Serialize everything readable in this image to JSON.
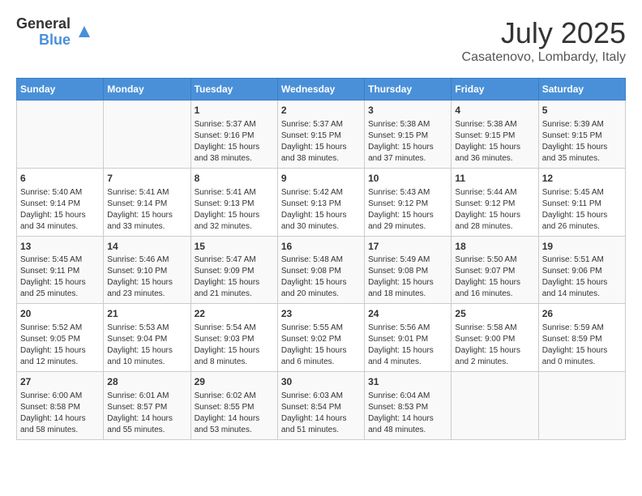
{
  "header": {
    "logo_general": "General",
    "logo_blue": "Blue",
    "month": "July 2025",
    "location": "Casatenovo, Lombardy, Italy"
  },
  "days_of_week": [
    "Sunday",
    "Monday",
    "Tuesday",
    "Wednesday",
    "Thursday",
    "Friday",
    "Saturday"
  ],
  "weeks": [
    [
      {
        "day": "",
        "content": ""
      },
      {
        "day": "",
        "content": ""
      },
      {
        "day": "1",
        "content": "Sunrise: 5:37 AM\nSunset: 9:16 PM\nDaylight: 15 hours and 38 minutes."
      },
      {
        "day": "2",
        "content": "Sunrise: 5:37 AM\nSunset: 9:15 PM\nDaylight: 15 hours and 38 minutes."
      },
      {
        "day": "3",
        "content": "Sunrise: 5:38 AM\nSunset: 9:15 PM\nDaylight: 15 hours and 37 minutes."
      },
      {
        "day": "4",
        "content": "Sunrise: 5:38 AM\nSunset: 9:15 PM\nDaylight: 15 hours and 36 minutes."
      },
      {
        "day": "5",
        "content": "Sunrise: 5:39 AM\nSunset: 9:15 PM\nDaylight: 15 hours and 35 minutes."
      }
    ],
    [
      {
        "day": "6",
        "content": "Sunrise: 5:40 AM\nSunset: 9:14 PM\nDaylight: 15 hours and 34 minutes."
      },
      {
        "day": "7",
        "content": "Sunrise: 5:41 AM\nSunset: 9:14 PM\nDaylight: 15 hours and 33 minutes."
      },
      {
        "day": "8",
        "content": "Sunrise: 5:41 AM\nSunset: 9:13 PM\nDaylight: 15 hours and 32 minutes."
      },
      {
        "day": "9",
        "content": "Sunrise: 5:42 AM\nSunset: 9:13 PM\nDaylight: 15 hours and 30 minutes."
      },
      {
        "day": "10",
        "content": "Sunrise: 5:43 AM\nSunset: 9:12 PM\nDaylight: 15 hours and 29 minutes."
      },
      {
        "day": "11",
        "content": "Sunrise: 5:44 AM\nSunset: 9:12 PM\nDaylight: 15 hours and 28 minutes."
      },
      {
        "day": "12",
        "content": "Sunrise: 5:45 AM\nSunset: 9:11 PM\nDaylight: 15 hours and 26 minutes."
      }
    ],
    [
      {
        "day": "13",
        "content": "Sunrise: 5:45 AM\nSunset: 9:11 PM\nDaylight: 15 hours and 25 minutes."
      },
      {
        "day": "14",
        "content": "Sunrise: 5:46 AM\nSunset: 9:10 PM\nDaylight: 15 hours and 23 minutes."
      },
      {
        "day": "15",
        "content": "Sunrise: 5:47 AM\nSunset: 9:09 PM\nDaylight: 15 hours and 21 minutes."
      },
      {
        "day": "16",
        "content": "Sunrise: 5:48 AM\nSunset: 9:08 PM\nDaylight: 15 hours and 20 minutes."
      },
      {
        "day": "17",
        "content": "Sunrise: 5:49 AM\nSunset: 9:08 PM\nDaylight: 15 hours and 18 minutes."
      },
      {
        "day": "18",
        "content": "Sunrise: 5:50 AM\nSunset: 9:07 PM\nDaylight: 15 hours and 16 minutes."
      },
      {
        "day": "19",
        "content": "Sunrise: 5:51 AM\nSunset: 9:06 PM\nDaylight: 15 hours and 14 minutes."
      }
    ],
    [
      {
        "day": "20",
        "content": "Sunrise: 5:52 AM\nSunset: 9:05 PM\nDaylight: 15 hours and 12 minutes."
      },
      {
        "day": "21",
        "content": "Sunrise: 5:53 AM\nSunset: 9:04 PM\nDaylight: 15 hours and 10 minutes."
      },
      {
        "day": "22",
        "content": "Sunrise: 5:54 AM\nSunset: 9:03 PM\nDaylight: 15 hours and 8 minutes."
      },
      {
        "day": "23",
        "content": "Sunrise: 5:55 AM\nSunset: 9:02 PM\nDaylight: 15 hours and 6 minutes."
      },
      {
        "day": "24",
        "content": "Sunrise: 5:56 AM\nSunset: 9:01 PM\nDaylight: 15 hours and 4 minutes."
      },
      {
        "day": "25",
        "content": "Sunrise: 5:58 AM\nSunset: 9:00 PM\nDaylight: 15 hours and 2 minutes."
      },
      {
        "day": "26",
        "content": "Sunrise: 5:59 AM\nSunset: 8:59 PM\nDaylight: 15 hours and 0 minutes."
      }
    ],
    [
      {
        "day": "27",
        "content": "Sunrise: 6:00 AM\nSunset: 8:58 PM\nDaylight: 14 hours and 58 minutes."
      },
      {
        "day": "28",
        "content": "Sunrise: 6:01 AM\nSunset: 8:57 PM\nDaylight: 14 hours and 55 minutes."
      },
      {
        "day": "29",
        "content": "Sunrise: 6:02 AM\nSunset: 8:55 PM\nDaylight: 14 hours and 53 minutes."
      },
      {
        "day": "30",
        "content": "Sunrise: 6:03 AM\nSunset: 8:54 PM\nDaylight: 14 hours and 51 minutes."
      },
      {
        "day": "31",
        "content": "Sunrise: 6:04 AM\nSunset: 8:53 PM\nDaylight: 14 hours and 48 minutes."
      },
      {
        "day": "",
        "content": ""
      },
      {
        "day": "",
        "content": ""
      }
    ]
  ]
}
